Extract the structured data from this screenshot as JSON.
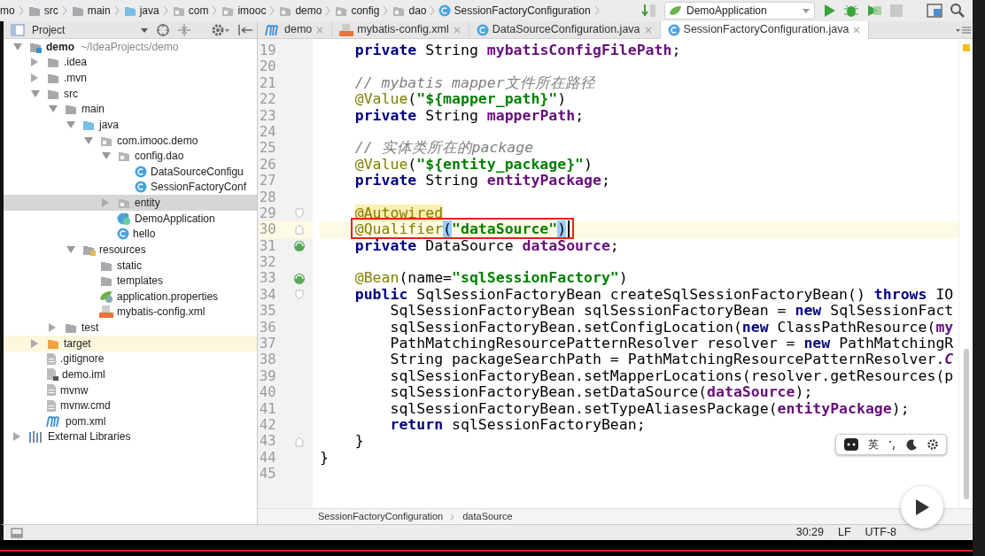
{
  "breadcrumb": [
    {
      "label": "mo",
      "kind": "none"
    },
    {
      "label": "src",
      "kind": "folder"
    },
    {
      "label": "main",
      "kind": "folder"
    },
    {
      "label": "java",
      "kind": "folder-source"
    },
    {
      "label": "com",
      "kind": "package"
    },
    {
      "label": "imooc",
      "kind": "package"
    },
    {
      "label": "demo",
      "kind": "package"
    },
    {
      "label": "config",
      "kind": "package"
    },
    {
      "label": "dao",
      "kind": "package"
    },
    {
      "label": "SessionFactoryConfiguration",
      "kind": "class"
    }
  ],
  "run_config": {
    "label": "DemoApplication"
  },
  "project_panel": {
    "title": "Project",
    "tree": [
      {
        "label": "demo",
        "note": "~/IdeaProjects/demo",
        "kind": "module",
        "expanded": true,
        "selected": false,
        "excluded": false,
        "children": [
          {
            "label": ".idea",
            "kind": "folder",
            "expanded": false,
            "selected": false,
            "excluded": false
          },
          {
            "label": ".mvn",
            "kind": "folder",
            "expanded": false,
            "selected": false,
            "excluded": false
          },
          {
            "label": "src",
            "kind": "folder",
            "expanded": true,
            "selected": false,
            "excluded": false,
            "children": [
              {
                "label": "main",
                "kind": "folder",
                "expanded": true,
                "selected": false,
                "excluded": false,
                "children": [
                  {
                    "label": "java",
                    "kind": "folder-source",
                    "expanded": true,
                    "selected": false,
                    "excluded": false,
                    "children": [
                      {
                        "label": "com.imooc.demo",
                        "kind": "package",
                        "expanded": true,
                        "selected": false,
                        "excluded": false,
                        "children": [
                          {
                            "label": "config.dao",
                            "kind": "package",
                            "expanded": true,
                            "selected": false,
                            "excluded": false,
                            "children": [
                              {
                                "label": "DataSourceConfigu",
                                "kind": "class",
                                "selected": false,
                                "excluded": false
                              },
                              {
                                "label": "SessionFactoryConf",
                                "kind": "class",
                                "selected": false,
                                "excluded": false
                              }
                            ]
                          },
                          {
                            "label": "entity",
                            "kind": "package",
                            "expanded": false,
                            "selected": true,
                            "excluded": false
                          },
                          {
                            "label": "DemoApplication",
                            "kind": "spring-class",
                            "selected": false,
                            "excluded": false
                          },
                          {
                            "label": "hello",
                            "kind": "class",
                            "selected": false,
                            "excluded": false
                          }
                        ]
                      }
                    ]
                  },
                  {
                    "label": "resources",
                    "kind": "folder-resources",
                    "expanded": true,
                    "selected": false,
                    "excluded": false,
                    "children": [
                      {
                        "label": "static",
                        "kind": "folder",
                        "selected": false,
                        "excluded": false
                      },
                      {
                        "label": "templates",
                        "kind": "folder",
                        "selected": false,
                        "excluded": false
                      },
                      {
                        "label": "application.properties",
                        "kind": "spring-props",
                        "selected": false,
                        "excluded": false
                      },
                      {
                        "label": "mybatis-config.xml",
                        "kind": "xml",
                        "selected": false,
                        "excluded": false
                      }
                    ]
                  }
                ]
              },
              {
                "label": "test",
                "kind": "folder",
                "expanded": false,
                "selected": false,
                "excluded": false
              }
            ]
          },
          {
            "label": "target",
            "kind": "folder-excluded",
            "expanded": false,
            "selected": false,
            "excluded": true
          },
          {
            "label": ".gitignore",
            "kind": "file",
            "selected": false,
            "excluded": false
          },
          {
            "label": "demo.iml",
            "kind": "iml",
            "selected": false,
            "excluded": false
          },
          {
            "label": "mvnw",
            "kind": "file",
            "selected": false,
            "excluded": false
          },
          {
            "label": "mvnw.cmd",
            "kind": "file",
            "selected": false,
            "excluded": false
          },
          {
            "label": "pom.xml",
            "kind": "maven",
            "selected": false,
            "excluded": false
          }
        ]
      },
      {
        "label": "External Libraries",
        "kind": "libraries",
        "expanded": false,
        "selected": false,
        "excluded": false
      }
    ]
  },
  "editor_tabs": [
    {
      "label": "demo",
      "kind": "maven",
      "selected": false
    },
    {
      "label": "mybatis-config.xml",
      "kind": "xml",
      "selected": false
    },
    {
      "label": "DataSourceConfiguration.java",
      "kind": "class",
      "selected": false
    },
    {
      "label": "SessionFactoryConfiguration.java",
      "kind": "class",
      "selected": true
    }
  ],
  "code": {
    "lines": [
      {
        "number": "19",
        "current": false,
        "tokens": [
          {
            "kind": "kw",
            "text": "    private"
          },
          {
            "kind": "p",
            "text": " String "
          },
          {
            "kind": "fld",
            "text": "mybatisConfigFilePath"
          },
          {
            "kind": "p",
            "text": ";"
          }
        ]
      },
      {
        "number": "20",
        "current": false
      },
      {
        "number": "21",
        "current": false,
        "tokens": [
          {
            "kind": "cmt",
            "text": "    // mybatis mapper文件所在路径"
          }
        ]
      },
      {
        "number": "22",
        "current": false,
        "tokens": [
          {
            "kind": "ann",
            "text": "    @Value"
          },
          {
            "kind": "p",
            "text": "("
          },
          {
            "kind": "str",
            "text": "\"${mapper_path}\""
          },
          {
            "kind": "p",
            "text": ")"
          }
        ]
      },
      {
        "number": "23",
        "current": false,
        "tokens": [
          {
            "kind": "kw",
            "text": "    private"
          },
          {
            "kind": "p",
            "text": " String "
          },
          {
            "kind": "fld",
            "text": "mapperPath"
          },
          {
            "kind": "p",
            "text": ";"
          }
        ]
      },
      {
        "number": "24",
        "current": false
      },
      {
        "number": "25",
        "current": false,
        "tokens": [
          {
            "kind": "cmt",
            "text": "    // 实体类所在的package"
          }
        ]
      },
      {
        "number": "26",
        "current": false,
        "tokens": [
          {
            "kind": "ann",
            "text": "    @Value"
          },
          {
            "kind": "p",
            "text": "("
          },
          {
            "kind": "str",
            "text": "\"${entity_package}\""
          },
          {
            "kind": "p",
            "text": ")"
          }
        ]
      },
      {
        "number": "27",
        "current": false,
        "tokens": [
          {
            "kind": "kw",
            "text": "    private"
          },
          {
            "kind": "p",
            "text": " String "
          },
          {
            "kind": "fld",
            "text": "entityPackage"
          },
          {
            "kind": "p",
            "text": ";"
          }
        ]
      },
      {
        "number": "28",
        "current": false
      },
      {
        "number": "29",
        "current": false,
        "marker": {
          "kind": "fold"
        },
        "tokens": [
          {
            "kind": "annw",
            "text": "    @Autowired"
          }
        ]
      },
      {
        "number": "30",
        "current": true,
        "marker": {
          "kind": "fold-end"
        },
        "caret": true,
        "boxed_tokens": [
          {
            "kind": "ann",
            "text": "    @Qualifier"
          },
          {
            "kind": "brace",
            "text": "("
          },
          {
            "kind": "str",
            "text": "\"dataSource\""
          },
          {
            "kind": "brace",
            "text": ")"
          }
        ]
      },
      {
        "number": "31",
        "current": false,
        "marker": {
          "kind": "bean"
        },
        "tokens": [
          {
            "kind": "kw",
            "text": "    private"
          },
          {
            "kind": "p",
            "text": " DataSource "
          },
          {
            "kind": "fld",
            "text": "dataSource"
          },
          {
            "kind": "p",
            "text": ";"
          }
        ]
      },
      {
        "number": "32",
        "current": false
      },
      {
        "number": "33",
        "current": false,
        "marker": {
          "kind": "bean"
        },
        "tokens": [
          {
            "kind": "ann",
            "text": "    @Bean"
          },
          {
            "kind": "p",
            "text": "(name="
          },
          {
            "kind": "str",
            "text": "\"sqlSessionFactory\""
          },
          {
            "kind": "p",
            "text": ")"
          }
        ]
      },
      {
        "number": "34",
        "current": false,
        "marker": {
          "kind": "fold"
        },
        "tokens": [
          {
            "kind": "kw",
            "text": "    public"
          },
          {
            "kind": "p",
            "text": " SqlSessionFactoryBean createSqlSessionFactoryBean() "
          },
          {
            "kind": "kw",
            "text": "throws"
          },
          {
            "kind": "p",
            "text": " IO"
          }
        ]
      },
      {
        "number": "35",
        "current": false,
        "tokens": [
          {
            "kind": "p",
            "text": "        SqlSessionFactoryBean sqlSessionFactoryBean = "
          },
          {
            "kind": "kw",
            "text": "new"
          },
          {
            "kind": "p",
            "text": " SqlSessionFact"
          }
        ]
      },
      {
        "number": "36",
        "current": false,
        "tokens": [
          {
            "kind": "p",
            "text": "        sqlSessionFactoryBean.setConfigLocation("
          },
          {
            "kind": "kw",
            "text": "new"
          },
          {
            "kind": "p",
            "text": " ClassPathResource("
          },
          {
            "kind": "fld",
            "text": "my"
          }
        ]
      },
      {
        "number": "37",
        "current": false,
        "tokens": [
          {
            "kind": "p",
            "text": "        PathMatchingResourcePatternResolver resolver = "
          },
          {
            "kind": "kw",
            "text": "new"
          },
          {
            "kind": "p",
            "text": " PathMatchingR"
          }
        ]
      },
      {
        "number": "38",
        "current": false,
        "tokens": [
          {
            "kind": "p",
            "text": "        String packageSearchPath = PathMatchingResourcePatternResolver."
          },
          {
            "kind": "static",
            "text": "C"
          }
        ]
      },
      {
        "number": "39",
        "current": false,
        "tokens": [
          {
            "kind": "p",
            "text": "        sqlSessionFactoryBean.setMapperLocations(resolver.getResources(p"
          }
        ]
      },
      {
        "number": "40",
        "current": false,
        "tokens": [
          {
            "kind": "p",
            "text": "        sqlSessionFactoryBean.setDataSource("
          },
          {
            "kind": "fld",
            "text": "dataSource"
          },
          {
            "kind": "p",
            "text": ");"
          }
        ]
      },
      {
        "number": "41",
        "current": false,
        "tokens": [
          {
            "kind": "p",
            "text": "        sqlSessionFactoryBean.setTypeAliasesPackage("
          },
          {
            "kind": "fld",
            "text": "entityPackage"
          },
          {
            "kind": "p",
            "text": ");"
          }
        ]
      },
      {
        "number": "42",
        "current": false,
        "tokens": [
          {
            "kind": "kw",
            "text": "        return"
          },
          {
            "kind": "p",
            "text": " sqlSessionFactoryBean;"
          }
        ]
      },
      {
        "number": "43",
        "current": false,
        "marker": {
          "kind": "fold-end"
        },
        "tokens": [
          {
            "kind": "p",
            "text": "    }"
          }
        ]
      },
      {
        "number": "44",
        "current": false,
        "tokens": [
          {
            "kind": "p",
            "text": "}"
          }
        ]
      },
      {
        "number": "45",
        "current": false
      }
    ]
  },
  "ime_bar": {
    "mode": "英"
  },
  "editor_breadcrumb": [
    "SessionFactoryConfiguration",
    "dataSource"
  ],
  "status_bar": {
    "position": "30:29",
    "line_separator": "LF",
    "encoding": "UTF-8"
  },
  "video": {
    "progress": {
      "level": 1
    }
  }
}
